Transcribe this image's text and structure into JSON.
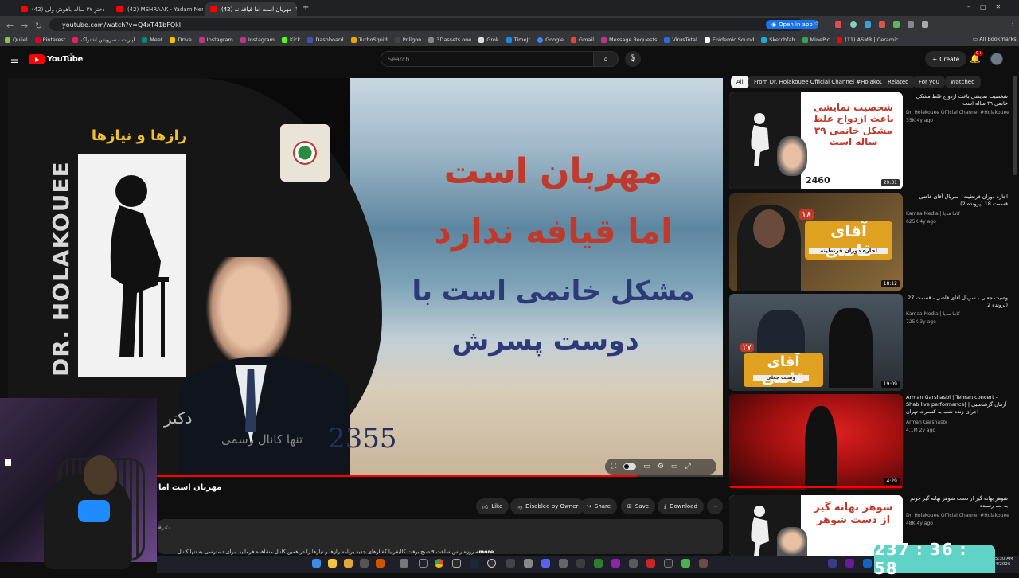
{
  "browser": {
    "tabs": [
      {
        "label": "(42) دخترِ ۳۷ ساله باهوش ولی",
        "active": false
      },
      {
        "label": "(42) MEHRAAK - Yadam Nemire",
        "active": false
      },
      {
        "label": "(42) مهربان است اما قیافه ند",
        "active": true
      }
    ],
    "url": "youtube.com/watch?v=Q4xT41bFQkI",
    "open_in_app": "Open in app",
    "bookmarks": [
      "Quiiel",
      "Pinterest",
      "آپارات - سرویس اشتراک",
      "Meet",
      "Drive",
      "Instagram",
      "Instagram",
      "Kick",
      "Dashboard",
      "TurboSquid",
      "Poligon",
      "3Dassets.one",
      "Grok",
      "TimeJr",
      "Google",
      "Gmail",
      "Message Requests",
      "VirusTotal",
      "Epidemic Sound",
      "Sketchfab",
      "MinePic",
      "(11) ASMR | Ceramic..."
    ],
    "all_bookmarks": "All Bookmarks"
  },
  "youtube": {
    "logo_text": "YouTube",
    "region": "DE",
    "search_placeholder": "Search",
    "create_label": "Create",
    "notif_count": "9+"
  },
  "video": {
    "overlay_line1": "مهربان است",
    "overlay_line2": "اما قیافه ندارد",
    "overlay_line3": "مشکل خانمی است با",
    "overlay_line4": "دوست پسرش",
    "episode_number": "2355",
    "poster_title": "رازها و نیازها",
    "poster_vertical": "DR. HOLAKOUEE",
    "side_text1": "دکتر",
    "side_text2": "تنها کانال رسمی",
    "progress_percent": 88
  },
  "below": {
    "title": "مهربان است اما",
    "like": "Like",
    "dislike": "Disabled by Owner",
    "share": "Share",
    "save": "Save",
    "download": "Download",
    "desc_hash": "#دکتر",
    "desc_text": "همه روزه راس ساعت ۹ صبح بوقت کالیفرنیا گفتارهای جدید برنامه رازها و نیازها را در همین کانال مشاهده فرمایید. برای دسترسی به تنها کانال",
    "desc_more": "...more"
  },
  "sidebar": {
    "chips": [
      {
        "label": "All",
        "active": true
      },
      {
        "label": "From Dr. Holakouee Official Channel #Holakouee",
        "active": false
      },
      {
        "label": "Related",
        "active": false
      },
      {
        "label": "For you",
        "active": false
      },
      {
        "label": "Watched",
        "active": false
      }
    ],
    "recs": [
      {
        "title": "شخصیت نمایشی باعث ازدواج غلط مشکل خانمی ۳۹ ساله است",
        "channel": "Dr. Holakouee Official Channel #Holakouee",
        "views": "35K",
        "age": "4y ago",
        "duration": "29:31",
        "thumb_text": "شخصیت نمایشی باعث ازدواج غلط مشکل خانمی ۳۹ ساله است",
        "thumb_num": "2460"
      },
      {
        "title": "اجاره دوران قرنطینه - سریال آقای قاضی - قسمت 18 (پرونده 2)",
        "channel": "Kamaa Media | کاما مدیا",
        "views": "625K",
        "age": "4y ago",
        "duration": "18:12",
        "thumb_text": "آقای قاضی",
        "thumb_sub": "اجاره دوران قرنطینه",
        "thumb_num": "۱۸"
      },
      {
        "title": "وصیت جعلی - سریال آقای قاضی - قسمت 27 (پرونده 2)",
        "channel": "Kamaa Media | کاما مدیا",
        "views": "725K",
        "age": "3y ago",
        "duration": "19:09",
        "thumb_text": "آقای قاضی",
        "thumb_sub": "وصیت جعلی",
        "thumb_num": "۲۷"
      },
      {
        "title": "Arman Garshasbi | Tehran concert - Shab live performance| آرمان گرشاسبی | اجرای زنده شب به کنسرت تهران",
        "channel": "Arman Garshasbi",
        "views": "4.1M",
        "age": "2y ago",
        "duration": "4:29"
      },
      {
        "title": "شوهر بهانه گیر از دست شوهر بهانه گیر جونم به لب رسیده",
        "channel": "Dr. Holakouee Official Channel #Holakouee",
        "views": "48K",
        "age": "4y ago",
        "thumb_text": "شوهر بهانه گیر از دست شوهر"
      }
    ]
  },
  "timer": "237 : 36 : 58",
  "clock": {
    "time": "5:30 AM",
    "date": "4/2026"
  },
  "colors": {
    "youtube_red": "#ff0000",
    "timer_bg": "#5fd3c6",
    "overlay_red": "#c0392b",
    "overlay_blue": "#2c3a7a"
  }
}
